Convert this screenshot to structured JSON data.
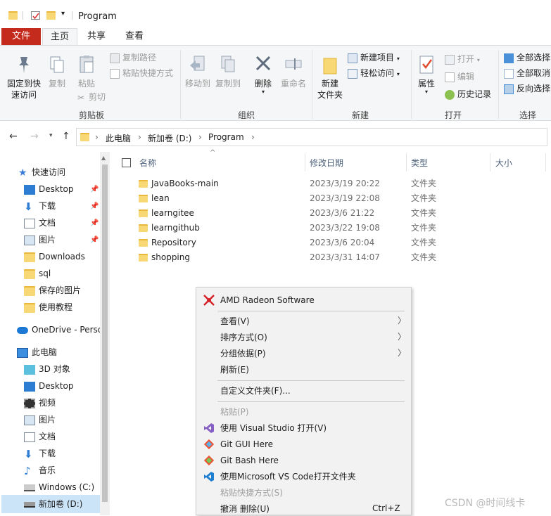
{
  "window": {
    "title": "Program"
  },
  "tabs": {
    "file": "文件",
    "home": "主页",
    "share": "共享",
    "view": "查看"
  },
  "ribbon": {
    "clipboard": {
      "pin_label_1": "固定到快",
      "pin_label_2": "速访问",
      "copy": "复制",
      "paste": "粘贴",
      "copy_path": "复制路径",
      "paste_shortcut": "粘贴快捷方式",
      "cut": "剪切",
      "group": "剪贴板"
    },
    "organize": {
      "move_to": "移动到",
      "copy_to": "复制到",
      "delete": "删除",
      "rename": "重命名",
      "group": "组织"
    },
    "new": {
      "new_folder_1": "新建",
      "new_folder_2": "文件夹",
      "new_item": "新建项目",
      "easy_access": "轻松访问",
      "group": "新建"
    },
    "open": {
      "properties": "属性",
      "open": "打开",
      "edit": "编辑",
      "history": "历史记录",
      "group": "打开"
    },
    "select": {
      "select_all": "全部选择",
      "select_none": "全部取消",
      "invert": "反向选择",
      "group": "选择"
    }
  },
  "address": {
    "crumbs": [
      "此电脑",
      "新加卷 (D:)",
      "Program"
    ],
    "sep": "›"
  },
  "nav": {
    "quick_access": "快速访问",
    "items": [
      "Desktop",
      "下载",
      "文档",
      "图片",
      "Downloads",
      "sql",
      "保存的图片",
      "使用教程"
    ],
    "onedrive": "OneDrive - Perso",
    "this_pc": "此电脑",
    "pc_items": [
      "3D 对象",
      "Desktop",
      "视频",
      "图片",
      "文档",
      "下载",
      "音乐",
      "Windows (C:)",
      "新加卷 (D:)"
    ]
  },
  "columns": {
    "name": "名称",
    "date": "修改日期",
    "type": "类型",
    "size": "大小"
  },
  "files": [
    {
      "name": "JavaBooks-main",
      "date": "2023/3/19 20:22",
      "type": "文件夹"
    },
    {
      "name": "lean",
      "date": "2023/3/19 22:08",
      "type": "文件夹"
    },
    {
      "name": "learngitee",
      "date": "2023/3/6 21:22",
      "type": "文件夹"
    },
    {
      "name": "learngithub",
      "date": "2023/3/22 19:08",
      "type": "文件夹"
    },
    {
      "name": "Repository",
      "date": "2023/3/6 20:04",
      "type": "文件夹"
    },
    {
      "name": "shopping",
      "date": "2023/3/31 14:07",
      "type": "文件夹"
    }
  ],
  "context_menu": {
    "amd": "AMD Radeon Software",
    "view": "查看(V)",
    "sort": "排序方式(O)",
    "group": "分组依据(P)",
    "refresh": "刷新(E)",
    "customize": "自定义文件夹(F)...",
    "paste": "粘贴(P)",
    "open_vs": "使用 Visual Studio 打开(V)",
    "git_gui": "Git GUI Here",
    "git_bash": "Git Bash Here",
    "open_vscode": "使用Microsoft VS Code打开文件夹",
    "paste_shortcut": "粘贴快捷方式(S)",
    "undo": "撤消 删除(U)",
    "undo_shortcut": "Ctrl+Z"
  },
  "watermark": "CSDN @时间线卡"
}
